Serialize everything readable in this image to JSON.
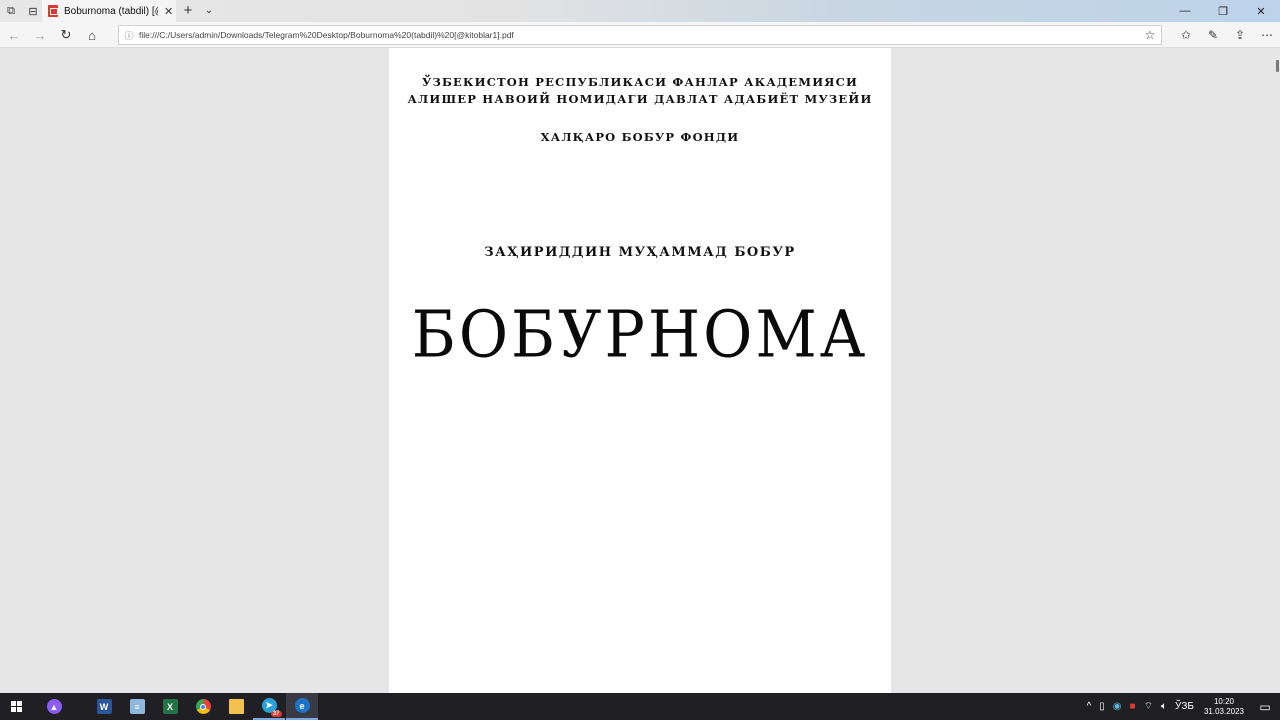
{
  "browser": {
    "tab_title": "Boburnoma (tabdil) [@ki",
    "address_url": "file:///C:/Users/admin/Downloads/Telegram%20Desktop/Boburnoma%20(tabdil)%20[@kitoblar1].pdf"
  },
  "document": {
    "header_line1": "ЎЗБЕКИСТОН РЕСПУБЛИКАСИ ФАНЛАР АКАДЕМИЯСИ",
    "header_line2": "АЛИШЕР НАВОИЙ НОМИДАГИ ДАВЛАТ АДАБИЁТ МУЗЕЙИ",
    "header_line3": "ХАЛҚАРО БОБУР ФОНДИ",
    "author": "ЗАҲИРИДДИН МУҲАММАД БОБУР",
    "title": "БОБУРНОМА"
  },
  "taskbar": {
    "telegram_badge": "37",
    "language": "ЎЗБ",
    "time": "10:20",
    "date": "31.03.2023"
  }
}
